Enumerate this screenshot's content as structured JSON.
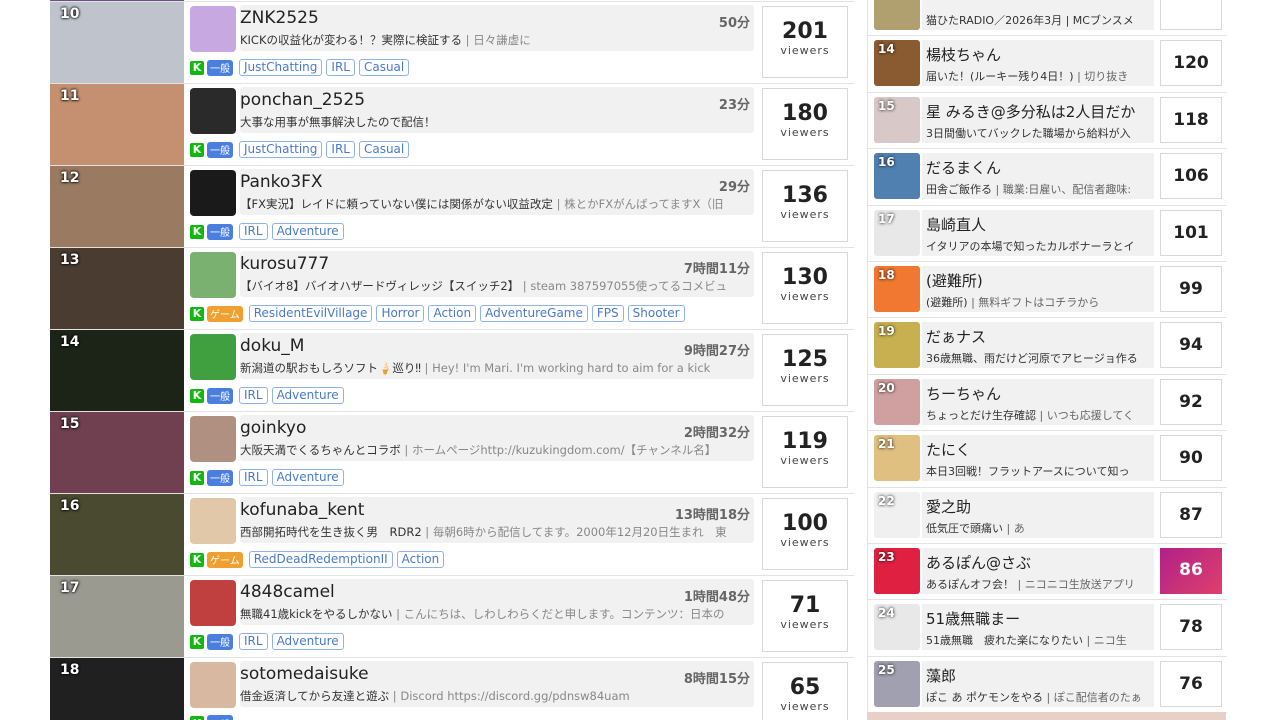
{
  "viewer_unit": "viewers",
  "left_rows": [
    {
      "rank": "",
      "name": "",
      "elapsed": "",
      "desc": "",
      "badge": "一般",
      "badge_type": "general",
      "tags": [
        "JustChatting",
        "IRL",
        "Casual"
      ],
      "viewers": "",
      "thumb_color": "#6a4f88",
      "avatar_color": "#cfcfcf"
    },
    {
      "rank": "10",
      "name": "ZNK2525",
      "elapsed": "50分",
      "desc": "KICKの収益化が変わる！？実際に検証する",
      "desc2": " | 日々謙虚に",
      "badge": "一般",
      "badge_type": "general",
      "tags": [
        "JustChatting",
        "IRL",
        "Casual"
      ],
      "viewers": "201",
      "thumb_color": "#bfc4cc",
      "avatar_color": "#c8a8e0"
    },
    {
      "rank": "11",
      "name": "ponchan_2525",
      "elapsed": "23分",
      "desc": "大事な用事が無事解決したので配信！",
      "desc2": "",
      "badge": "一般",
      "badge_type": "general",
      "tags": [
        "JustChatting",
        "IRL",
        "Casual"
      ],
      "viewers": "180",
      "thumb_color": "#c49070",
      "avatar_color": "#2a2a2a"
    },
    {
      "rank": "12",
      "name": "Panko3FX",
      "elapsed": "29分",
      "desc": "【FX実況】レイドに頼っていない僕には関係がない収益改定",
      "desc2": " | 株とかFXがんばってますX（旧",
      "badge": "一般",
      "badge_type": "general",
      "tags": [
        "IRL",
        "Adventure"
      ],
      "viewers": "136",
      "thumb_color": "#9a7a60",
      "avatar_color": "#1a1a1a"
    },
    {
      "rank": "13",
      "name": "kurosu777",
      "elapsed": "7時間11分",
      "desc": "【バイオ8】バイオハザードヴィレッジ【スイッチ2】",
      "desc2": " | steam 387597055使ってるコメビュ",
      "badge": "ゲーム",
      "badge_type": "game",
      "tags": [
        "ResidentEvilVillage",
        "Horror",
        "Action",
        "AdventureGame",
        "FPS",
        "Shooter"
      ],
      "viewers": "130",
      "thumb_color": "#4a3c30",
      "avatar_color": "#7ab070"
    },
    {
      "rank": "14",
      "name": "doku_M",
      "elapsed": "9時間27分",
      "desc": "新潟道の駅おもしろソフト🍦巡り‼",
      "desc2": " | Hey! I'm Mari. I'm working hard to aim for a kick",
      "badge": "一般",
      "badge_type": "general",
      "tags": [
        "IRL",
        "Adventure"
      ],
      "viewers": "125",
      "thumb_color": "#1c2418",
      "avatar_color": "#40a040"
    },
    {
      "rank": "15",
      "name": "goinkyo",
      "elapsed": "2時間32分",
      "desc": "大阪天満でくるちゃんとコラボ",
      "desc2": " | ホームページhttp://kuzukingdom.com/【チャンネル名】",
      "badge": "一般",
      "badge_type": "general",
      "tags": [
        "IRL",
        "Adventure"
      ],
      "viewers": "119",
      "thumb_color": "#704050",
      "avatar_color": "#b09080"
    },
    {
      "rank": "16",
      "name": "kofunaba_kent",
      "elapsed": "13時間18分",
      "desc": "西部開拓時代を生き抜く男　RDR2",
      "desc2": " | 毎朝6時から配信してます。2000年12月20日生まれ　東",
      "badge": "ゲーム",
      "badge_type": "game",
      "tags": [
        "RedDeadRedemptionII",
        "Action"
      ],
      "viewers": "100",
      "thumb_color": "#4a4a30",
      "avatar_color": "#e0c8a8"
    },
    {
      "rank": "17",
      "name": "4848camel",
      "elapsed": "1時間48分",
      "desc": "無職41歳kickをやるしかない",
      "desc2": " | こんにちは、しわしわらくだと申します。コンテンツ：日本の",
      "badge": "一般",
      "badge_type": "general",
      "tags": [
        "IRL",
        "Adventure"
      ],
      "viewers": "71",
      "thumb_color": "#9a9a90",
      "avatar_color": "#c04040"
    },
    {
      "rank": "18",
      "name": "sotomedaisuke",
      "elapsed": "8時間15分",
      "desc": "借金返済してから友達と遊ぶ",
      "desc2": " | Discord https://discord.gg/pdnsw84uam",
      "badge": "一般",
      "badge_type": "general",
      "tags": [],
      "viewers": "65",
      "thumb_color": "#202020",
      "avatar_color": "#d8b8a0"
    }
  ],
  "right_rows": [
    {
      "rank": "",
      "name": "",
      "desc": "猫ひたRADIO／2026年3月 | MCブンスメ",
      "count": "",
      "avatar_color": "#b0a070"
    },
    {
      "rank": "14",
      "name": "楊枝ちゃん",
      "desc": "届いた！(ルーキー残り4日！)",
      "desc2": " | 切り抜き",
      "count": "120",
      "avatar_color": "#8a5a30"
    },
    {
      "rank": "15",
      "name": "星 みるき@多分私は2人目だか",
      "desc": "3日間働いてバックレた職場から給料が入",
      "desc2": "",
      "count": "118",
      "avatar_color": "#d8c8c8"
    },
    {
      "rank": "16",
      "name": "だるまくん",
      "desc": "田舎ご飯作る",
      "desc2": " | 職業:日雇い、配信者趣味:",
      "count": "106",
      "avatar_color": "#5080b0"
    },
    {
      "rank": "17",
      "name": "島崎直人",
      "desc": "イタリアの本場で知ったカルボナーラとイ",
      "desc2": "",
      "count": "101",
      "avatar_color": "#e8e8e8"
    },
    {
      "rank": "18",
      "name": "(避難所)",
      "desc": "(避難所)",
      "desc2": " | 無料ギフトはコチラから",
      "count": "99",
      "avatar_color": "#f07830"
    },
    {
      "rank": "19",
      "name": "だぁナス",
      "desc": "36歳無職、雨だけど河原でアヒージョ作る",
      "desc2": "",
      "count": "94",
      "avatar_color": "#c8b050"
    },
    {
      "rank": "20",
      "name": "ちーちゃん",
      "desc": "ちょっとだけ生存確認",
      "desc2": " | いつも応援してく",
      "count": "92",
      "avatar_color": "#d0a0a0"
    },
    {
      "rank": "21",
      "name": "たにく",
      "desc": "本日3回戦！フラットアースについて知っ",
      "desc2": "",
      "count": "90",
      "avatar_color": "#e0c080"
    },
    {
      "rank": "22",
      "name": "愛之助",
      "desc": "低気圧で頭痛い",
      "desc2": " | あ",
      "count": "87",
      "avatar_color": "#f0f0f0"
    },
    {
      "rank": "23",
      "name": "あるぽん@さぶ",
      "desc": "あるぽんオフ会！",
      "desc2": " | ニコニコ生放送アプリ",
      "count": "86",
      "avatar_color": "#e02040",
      "count_thumb": true
    },
    {
      "rank": "24",
      "name": "51歳無職まー",
      "desc": "51歳無職　疲れた楽になりたい",
      "desc2": " | ニコ生",
      "count": "78",
      "avatar_color": "#e8e8e8"
    },
    {
      "rank": "25",
      "name": "藻郎",
      "desc": "ぽこ あ ポケモンをやる",
      "desc2": " | ぽこ配信者のたぁ",
      "count": "76",
      "avatar_color": "#a0a0b0"
    }
  ]
}
